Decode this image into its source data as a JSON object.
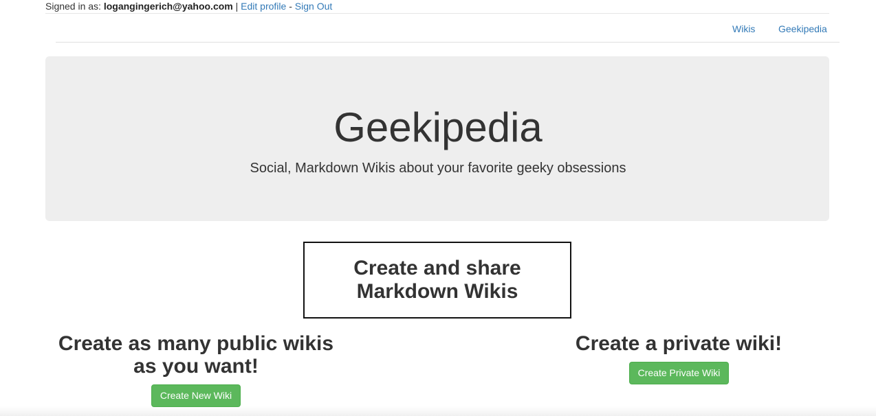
{
  "signin": {
    "prefix": "Signed in as: ",
    "email": "logangingerich@yahoo.com",
    "separator": " | ",
    "edit_profile": "Edit profile",
    "dash": " - ",
    "sign_out": "Sign Out"
  },
  "nav": {
    "wikis": "Wikis",
    "brand": "Geekipedia"
  },
  "jumbotron": {
    "title": "Geekipedia",
    "subtitle": "Social, Markdown Wikis about your favorite geeky obsessions"
  },
  "feature": {
    "title": "Create and share Markdown Wikis"
  },
  "public": {
    "heading": "Create as many public wikis as you want!",
    "button": "Create New Wiki"
  },
  "private": {
    "heading": "Create a private wiki!",
    "button": "Create Private Wiki"
  },
  "colors": {
    "link": "#337ab7",
    "button_green": "#5cb85c",
    "jumbotron_bg": "#eeeeee"
  }
}
